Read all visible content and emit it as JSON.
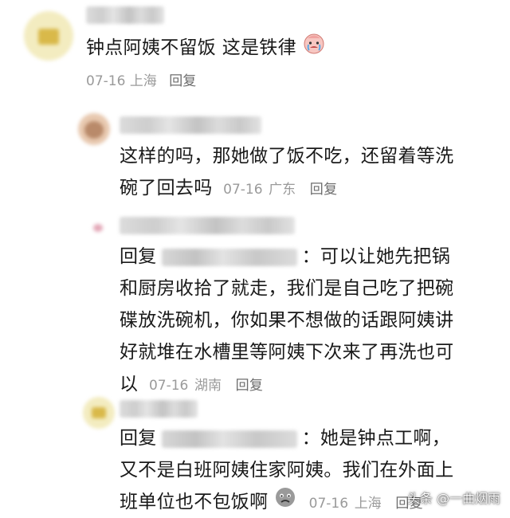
{
  "comment": {
    "text": "钟点阿姨不留饭 这是铁律",
    "emoji": "crying-face-icon",
    "date": "07-16",
    "location": "上海",
    "reply_label": "回复"
  },
  "replies": [
    {
      "line1": "这样的吗，那她做了饭不吃，还留着等洗",
      "line2": "碗了回去吗",
      "date": "07-16",
      "location": "广东",
      "reply_label": "回复"
    },
    {
      "prefix": "回复",
      "colon": "：",
      "line1": "可以让她先把锅",
      "line2": "和厨房收拾了就走，我们是自己吃了把碗",
      "line3": "碟放洗碗机，你如果不想做的话跟阿姨讲",
      "line4": "好就堆在水槽里等阿姨下次来了再洗也可",
      "line5": "以",
      "date": "07-16",
      "location": "湖南",
      "reply_label": "回复"
    },
    {
      "prefix": "回复",
      "colon": "：",
      "line1": "她是钟点工啊，",
      "line2": "又不是白班阿姨住家阿姨。我们在外面上",
      "line3": "班单位也不包饭啊",
      "emoji": "sad-face-icon",
      "date": "07-16",
      "location": "上海",
      "reply_label": "回复"
    }
  ],
  "watermark": "头条 @一曲烟雨"
}
